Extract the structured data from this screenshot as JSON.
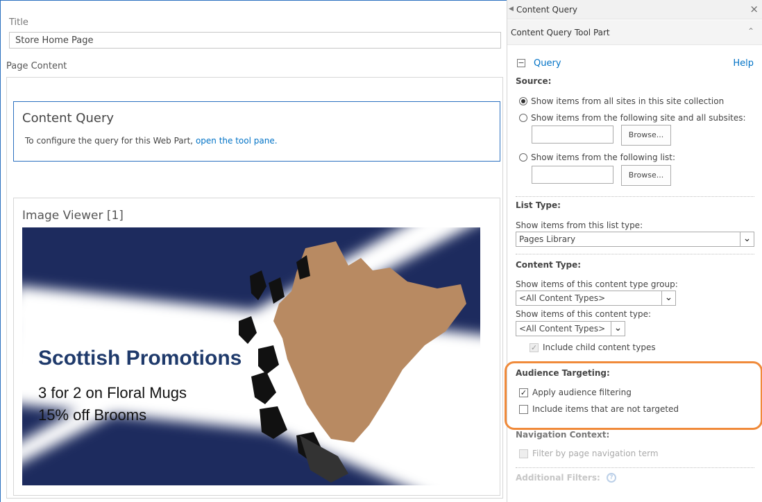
{
  "editor": {
    "title_label": "Title",
    "title_value": "Store Home Page",
    "page_content_label": "Page Content",
    "content_query_part": {
      "title": "Content Query",
      "text": "To configure the query for this Web Part,",
      "link": "open the tool pane."
    },
    "image_viewer_part": {
      "title": "Image Viewer [1]",
      "promo": {
        "headline": "Scottish Promotions",
        "lines": [
          "3 for 2 on Floral Mugs",
          "15% off Brooms"
        ]
      }
    }
  },
  "pane": {
    "header_title": "Content Query",
    "close": "×",
    "toolpart_title": "Content Query Tool Part",
    "collapse_icon": "double-chevron-up",
    "query": {
      "toggle": "−",
      "label": "Query",
      "help": "Help"
    },
    "source": {
      "heading": "Source:",
      "options": [
        {
          "label": "Show items from all sites in this site collection",
          "selected": true
        },
        {
          "label": "Show items from the following site and all subsites:",
          "selected": false
        },
        {
          "label": "Show items from the following list:",
          "selected": false
        }
      ],
      "browse": "Browse..."
    },
    "list_type": {
      "heading": "List Type:",
      "label": "Show items from this list type:",
      "value": "Pages Library"
    },
    "content_type": {
      "heading": "Content Type:",
      "group_label": "Show items of this content type group:",
      "group_value": "<All Content Types>",
      "type_label": "Show items of this content type:",
      "type_value": "<All Content Types>",
      "include_child": "Include child content types"
    },
    "audience": {
      "heading": "Audience Targeting:",
      "apply": "Apply audience filtering",
      "include": "Include items that are not targeted"
    },
    "navigation": {
      "heading": "Navigation Context:",
      "filter": "Filter by page navigation term"
    },
    "additional": {
      "heading": "Additional Filters:"
    }
  },
  "colors": {
    "accent_blue": "#0072c6",
    "highlight_orange": "#f08a3a",
    "saltire_navy": "#1d2b5e",
    "map_tan": "#b88a62"
  }
}
